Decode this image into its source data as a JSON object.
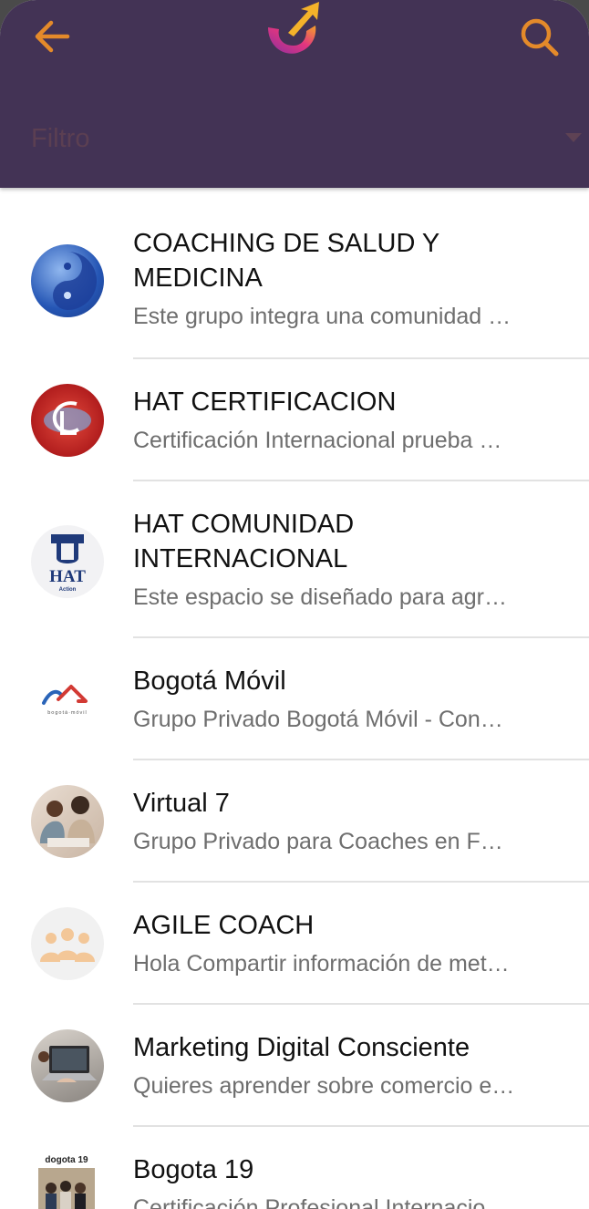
{
  "header": {
    "back_icon": "arrow-left-icon",
    "search_icon": "search-icon",
    "logo": "app-logo",
    "filter_label": "Filtro",
    "colors": {
      "bar": "#433355",
      "accent": "#e48a2a"
    }
  },
  "groups": [
    {
      "title": "COACHING DE SALUD Y MEDICINA",
      "desc": "Este grupo integra una comunidad …"
    },
    {
      "title": "HAT CERTIFICACION",
      "desc": "Certificación Internacional prueba …"
    },
    {
      "title": "HAT COMUNIDAD INTERNACIONAL",
      "desc": "Este espacio se diseñado para agr…",
      "logo_text": "HAT",
      "logo_sub": "Action"
    },
    {
      "title": "Bogotá Móvil",
      "desc": "Grupo Privado Bogotá Móvil - Con…",
      "logo_sub": "bogotá·móvil"
    },
    {
      "title": "Virtual 7",
      "desc": "Grupo Privado para Coaches en F…"
    },
    {
      "title": "AGILE COACH",
      "desc": "Hola Compartir información de met…"
    },
    {
      "title": "Marketing Digital Consciente",
      "desc": "Quieres aprender sobre comercio e…"
    },
    {
      "title": "Bogota 19",
      "desc": "Certificación Profesional Internacio…",
      "logo_text": "dogota 19"
    }
  ]
}
